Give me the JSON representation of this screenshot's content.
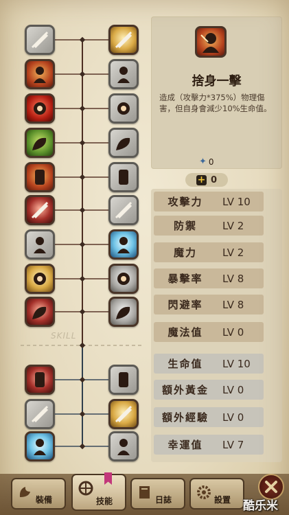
{
  "tree": {
    "watermark": "SKILL",
    "left_column": [
      {
        "name": "slash",
        "state": "locked"
      },
      {
        "name": "dash-strike",
        "state": "active"
      },
      {
        "name": "roar",
        "state": "red"
      },
      {
        "name": "power-arm",
        "state": "green"
      },
      {
        "name": "self-sacrifice",
        "state": "active"
      },
      {
        "name": "blade-thrust",
        "state": "darkred"
      },
      {
        "name": "ghost",
        "state": "locked"
      },
      {
        "name": "golden-flex",
        "state": "gold"
      },
      {
        "name": "cross-slash",
        "state": "darkred"
      },
      {
        "name": "ancient-gate",
        "state": "darkred"
      },
      {
        "name": "spider-guard",
        "state": "locked"
      },
      {
        "name": "frost-spirit",
        "state": "blue"
      }
    ],
    "right_column": [
      {
        "name": "holy-shield",
        "state": "gold"
      },
      {
        "name": "fist",
        "state": "locked"
      },
      {
        "name": "lightning",
        "state": "locked"
      },
      {
        "name": "armor",
        "state": "locked"
      },
      {
        "name": "muscle",
        "state": "locked"
      },
      {
        "name": "crack",
        "state": "locked"
      },
      {
        "name": "wind-blade",
        "state": "blue"
      },
      {
        "name": "whirl",
        "state": "gray"
      },
      {
        "name": "warrior",
        "state": "gray"
      },
      {
        "name": "eye-relic",
        "state": "locked"
      },
      {
        "name": "seeing-eye",
        "state": "gold"
      },
      {
        "name": "summon",
        "state": "locked"
      }
    ]
  },
  "detail": {
    "title": "捨身一擊",
    "description": "造成（攻擊力*375%）物理傷害，但自身會減少10%生命值。",
    "skill_points": "0"
  },
  "stat_points": "0",
  "stats": [
    {
      "label": "攻擊力",
      "level": "LV 10"
    },
    {
      "label": "防禦",
      "level": "LV 2"
    },
    {
      "label": "魔力",
      "level": "LV 2"
    },
    {
      "label": "暴擊率",
      "level": "LV 8"
    },
    {
      "label": "閃避率",
      "level": "LV 8"
    },
    {
      "label": "魔法值",
      "level": "LV 0"
    },
    {
      "label": "生命值",
      "level": "LV 10"
    },
    {
      "label": "額外黃金",
      "level": "LV 0"
    },
    {
      "label": "額外經驗",
      "level": "LV 0"
    },
    {
      "label": "幸運值",
      "level": "LV 7"
    }
  ],
  "tabs": [
    {
      "label": "裝備",
      "icon": "equipment-icon"
    },
    {
      "label": "技能",
      "icon": "skill-icon"
    },
    {
      "label": "日誌",
      "icon": "journal-icon"
    },
    {
      "label": "設置",
      "icon": "settings-icon"
    }
  ],
  "watermark": "酷乐米"
}
